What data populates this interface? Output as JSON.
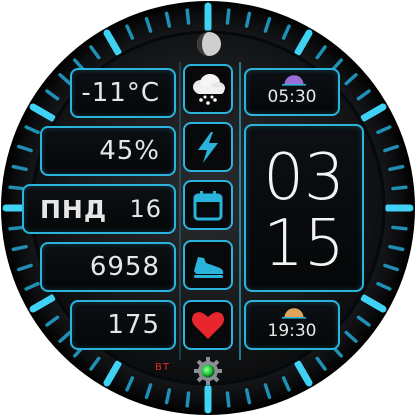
{
  "complications": {
    "temperature": "-11°C",
    "humidity": "45%",
    "day_of_week": "ПНД",
    "day_number": "16",
    "steps": "6958",
    "heart_rate": "175"
  },
  "clock": {
    "hours": "03",
    "minutes": "15"
  },
  "sun": {
    "sunrise": "05:30",
    "sunset": "19:30"
  },
  "status": {
    "bluetooth_label": "BT"
  },
  "icons": {
    "weather": "snow-cloud-icon",
    "battery": "lightning-bolt-icon",
    "date": "calendar-icon",
    "steps": "sneaker-icon",
    "heart": "heart-icon",
    "moon": "moon-phase-icon",
    "settings": "gear-icon"
  },
  "colors": {
    "accent": "#2ab4dc",
    "heart": "#e8262e",
    "bt": "#e02a2a"
  }
}
